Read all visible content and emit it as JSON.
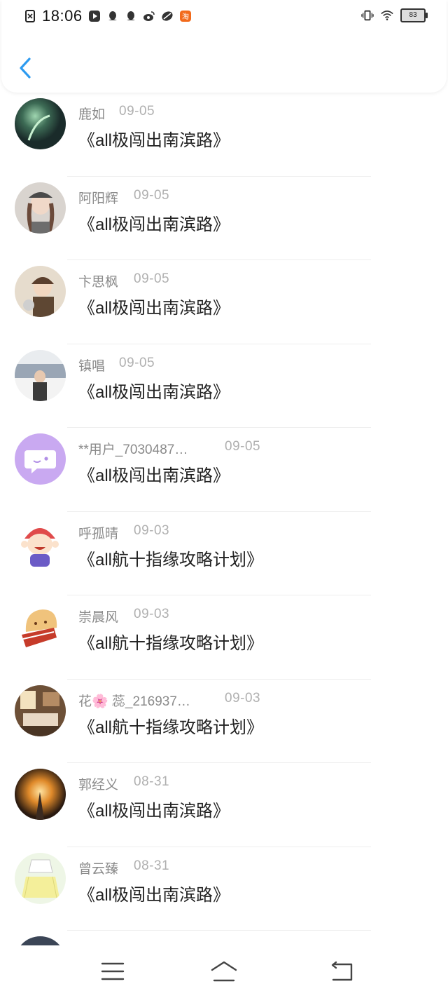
{
  "status_bar": {
    "time": "18:06",
    "battery": "83",
    "left_icons": [
      "sim-off-icon",
      "video-icon",
      "qq-icon",
      "qq-icon-2",
      "weibo-icon",
      "app-icon",
      "taobao-icon"
    ],
    "right_icons": [
      "vibrate-icon",
      "wifi-icon"
    ]
  },
  "header": {
    "back_icon": "chevron-left-icon",
    "accent": "#2d9bf0"
  },
  "list": [
    {
      "name": "鹿如",
      "date": "09-05",
      "title": "《all极闯出南滨路》",
      "avatar_color": "#2f5a4a"
    },
    {
      "name": "阿阳辉",
      "date": "09-05",
      "title": "《all极闯出南滨路》",
      "avatar_color": "#8a7566"
    },
    {
      "name": "卞思枫",
      "date": "09-05",
      "title": "《all极闯出南滨路》",
      "avatar_color": "#9a8060"
    },
    {
      "name": "镇唱",
      "date": "09-05",
      "title": "《all极闯出南滨路》",
      "avatar_color": "#7d8797"
    },
    {
      "name": "**用户_7030487…",
      "date": "09-05",
      "title": "《all极闯出南滨路》",
      "avatar_color": "#c9a9f1"
    },
    {
      "name": "呼孤晴",
      "date": "09-03",
      "title": "《all航十指缘攻略计划》",
      "avatar_color": "#e04b4b"
    },
    {
      "name": "崇晨风",
      "date": "09-03",
      "title": "《all航十指缘攻略计划》",
      "avatar_color": "#e8b86c"
    },
    {
      "name": "花🌸 蕊_216937…",
      "date": "09-03",
      "title": "《all航十指缘攻略计划》",
      "avatar_color": "#8b6b4e"
    },
    {
      "name": "郭经义",
      "date": "08-31",
      "title": "《all极闯出南滨路》",
      "avatar_color": "#b5651d"
    },
    {
      "name": "曾云臻",
      "date": "08-31",
      "title": "《all极闯出南滨路》",
      "avatar_color": "#f3f6d0"
    }
  ],
  "nav_bar": {
    "icons": [
      "menu-icon",
      "home-icon",
      "back-nav-icon"
    ]
  }
}
